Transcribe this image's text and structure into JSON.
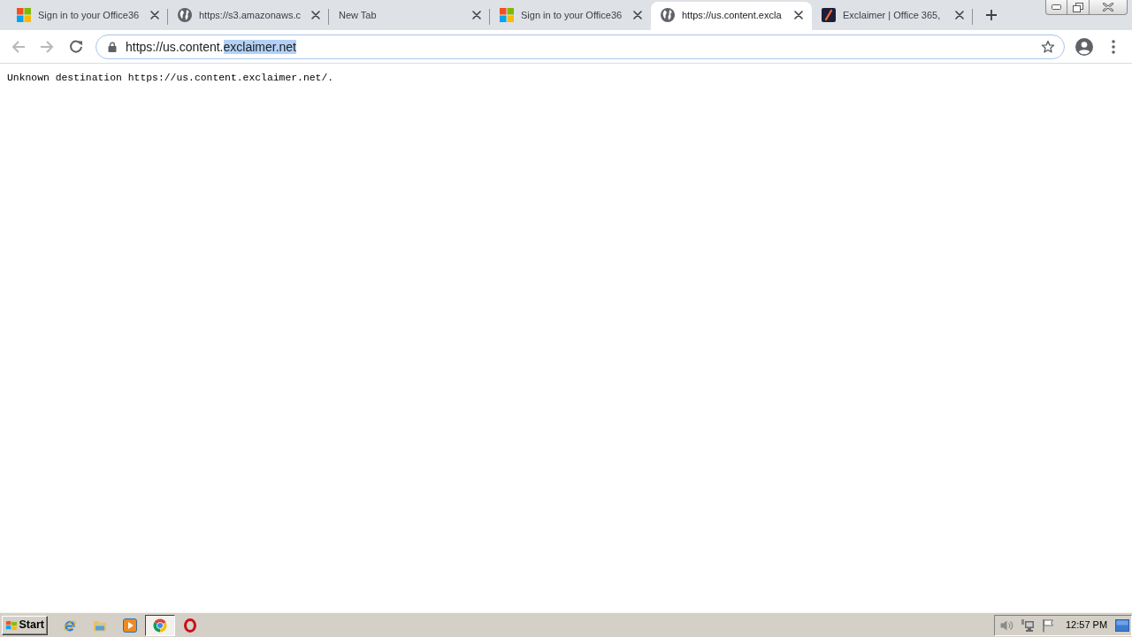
{
  "tabs": [
    {
      "title": "Sign in to your Office36",
      "favicon": {
        "kind": "windows"
      },
      "selected": false
    },
    {
      "title": "https://s3.amazonaws.c",
      "favicon": {
        "kind": "globe"
      },
      "selected": false
    },
    {
      "title": "New Tab",
      "selected": false
    },
    {
      "title": "Sign in to your Office36",
      "favicon": {
        "kind": "windows"
      },
      "selected": false
    },
    {
      "title": "https://us.content.excla",
      "favicon": {
        "kind": "globe"
      },
      "selected": true
    },
    {
      "title": "Exclaimer | Office 365,",
      "favicon": {
        "kind": "exclaimer"
      },
      "selected": false
    }
  ],
  "address_bar": {
    "url_segments": [
      {
        "text": "https://us.content.",
        "selected": false
      },
      {
        "text": "exclaimer.net",
        "selected": true
      }
    ]
  },
  "page": {
    "message": "Unknown destination https://us.content.exclaimer.net/."
  },
  "taskbar": {
    "start_label": "Start",
    "apps": [
      {
        "kind": "ie",
        "selected": false
      },
      {
        "kind": "explorer",
        "selected": false
      },
      {
        "kind": "media",
        "selected": false
      },
      {
        "kind": "chrome",
        "selected": true
      },
      {
        "kind": "opera",
        "selected": false
      }
    ],
    "clock": "12:57 PM"
  }
}
